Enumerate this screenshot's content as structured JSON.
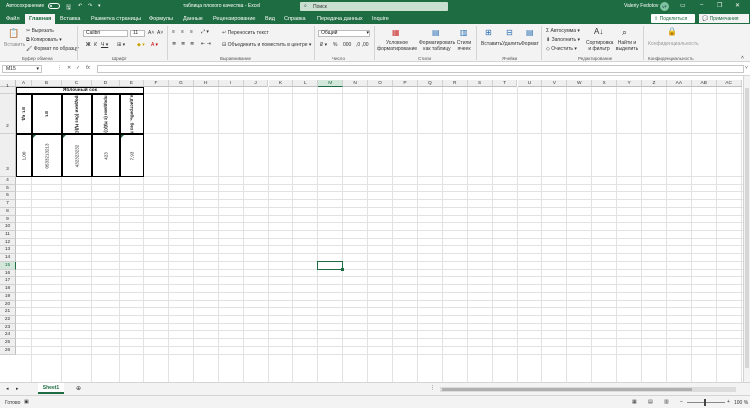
{
  "titlebar": {
    "autosave_label": "Автосохранение",
    "autosave_state": "Откл.",
    "filename": "таблица плохого качества",
    "app": "Excel",
    "search_placeholder": "Поиск",
    "user": "Valeriy Fedotov",
    "user_initials": "VF"
  },
  "tabs": [
    "Файл",
    "Главная",
    "Вставка",
    "Разметка страницы",
    "Формулы",
    "Данные",
    "Рецензирование",
    "Вид",
    "Справка",
    "Передача данных",
    "Inquire"
  ],
  "active_tab": "Главная",
  "share_label": "Поделиться",
  "notes_label": "Примечания",
  "ribbon": {
    "clipboard": {
      "paste": "Вставить",
      "cut": "Вырезать",
      "copy": "Копировать",
      "format_painter": "Формат по образцу",
      "label": "Буфер обмена"
    },
    "font": {
      "name": "Calibri",
      "size": "11",
      "label": "Шрифт"
    },
    "alignment": {
      "wrap": "Переносить текст",
      "merge": "Объединить и поместить в центре",
      "label": "Выравнивание"
    },
    "number": {
      "format": "Общий",
      "label": "Число"
    },
    "styles": {
      "conditional": "Условное форматирование",
      "as_table": "Форматировать как таблицу",
      "cell_styles": "Стили ячеек",
      "label": "Стили"
    },
    "cells": {
      "insert": "Вставить",
      "delete": "Удалить",
      "format": "Формат",
      "label": "Ячейки"
    },
    "editing": {
      "autosum": "Автосумма",
      "fill": "Заполнить",
      "clear": "Очистить",
      "sort": "Сортировка и фильтр",
      "find": "Найти и выделить",
      "label": "Редактирование"
    },
    "confidentiality": {
      "btn": "Конфиденциальность",
      "label": "Конфиденциальность"
    }
  },
  "formula_bar": {
    "namebox": "M15",
    "fx": "fx",
    "value": ""
  },
  "columns": [
    "A",
    "B",
    "C",
    "D",
    "E",
    "F",
    "G",
    "H",
    "I",
    "J",
    "K",
    "L",
    "M",
    "N",
    "O",
    "P",
    "Q",
    "R",
    "S",
    "T",
    "U",
    "V",
    "W",
    "X",
    "Y",
    "Z",
    "AA",
    "AB",
    "AC"
  ],
  "rows": [
    "1",
    "2",
    "3",
    "4",
    "5",
    "6",
    "7",
    "8",
    "9",
    "10",
    "11",
    "12",
    "13",
    "14",
    "15",
    "16",
    "17",
    "18",
    "19",
    "20",
    "21",
    "22",
    "23",
    "24",
    "25",
    "26"
  ],
  "selected": {
    "column": "M",
    "row": "15"
  },
  "table": {
    "title": "Яблочный сок",
    "headers": [
      "шт. ед.",
      "шт.",
      "цена продажи (без НДС), руб.",
      "цена продажи (с НДС), руб.",
      "цена дистрибь. без НДС"
    ],
    "values": [
      "1,00",
      "0533213213",
      "432323232",
      "423",
      "7,93"
    ]
  },
  "sheet_tab": "Sheet1",
  "status": {
    "ready": "Готово",
    "zoom": "100 %"
  }
}
